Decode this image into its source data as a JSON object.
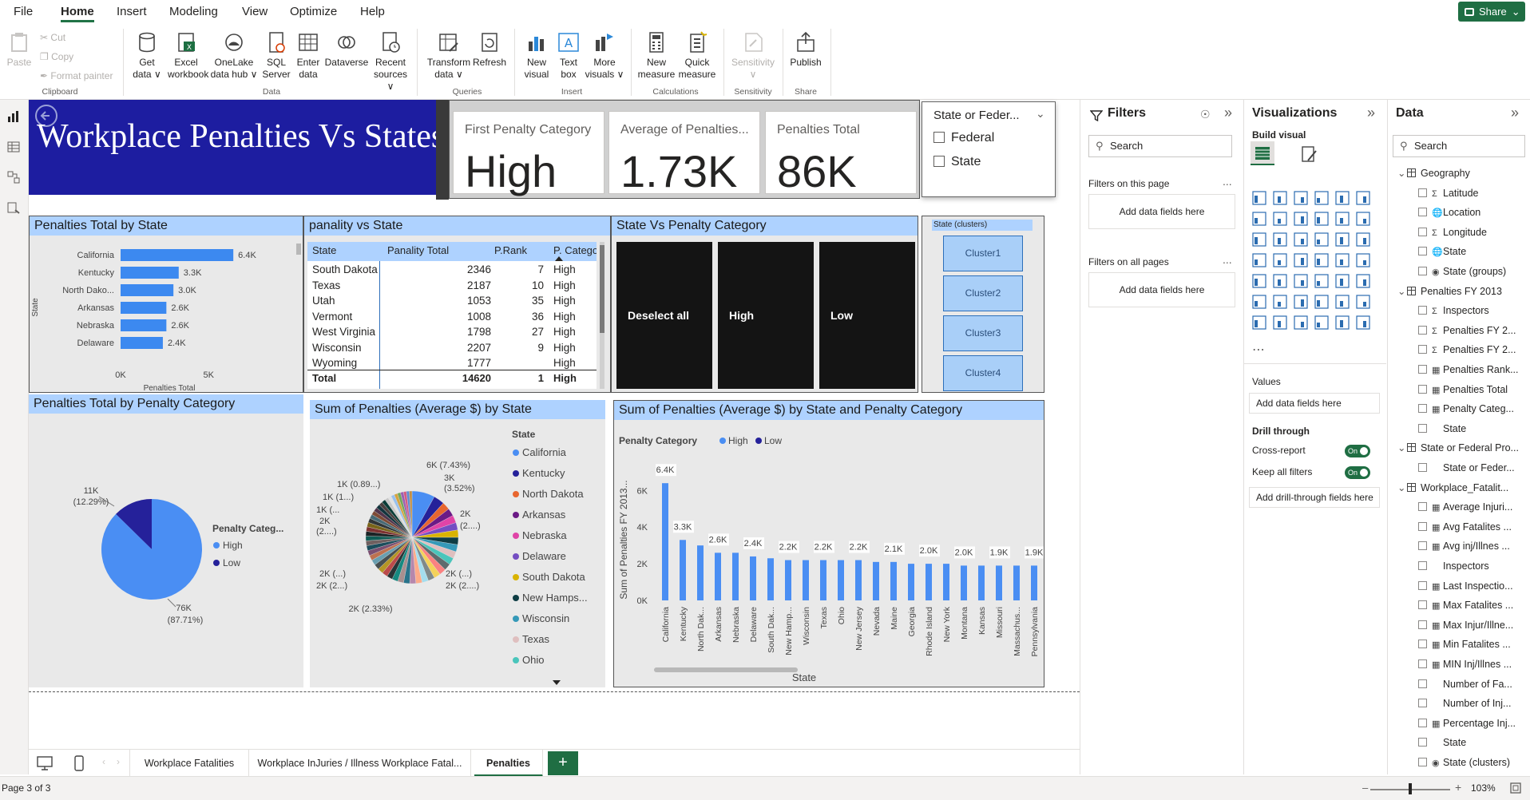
{
  "menu": {
    "items": [
      "File",
      "Home",
      "Insert",
      "Modeling",
      "View",
      "Optimize",
      "Help"
    ],
    "share": "Share"
  },
  "ribbon": {
    "paste": "Paste",
    "cut": "Cut",
    "copy": "Copy",
    "format_painter": "Format painter",
    "get_data": [
      "Get",
      "data ∨"
    ],
    "excel": [
      "Excel",
      "workbook"
    ],
    "onelake": [
      "OneLake",
      "data hub ∨"
    ],
    "sql": [
      "SQL",
      "Server"
    ],
    "enter_data": [
      "Enter",
      "data"
    ],
    "dataverse": "Dataverse",
    "recent": [
      "Recent",
      "sources ∨"
    ],
    "transform": [
      "Transform",
      "data ∨"
    ],
    "refresh": "Refresh",
    "new_visual": [
      "New",
      "visual"
    ],
    "text_box": [
      "Text",
      "box"
    ],
    "more_visuals": [
      "More",
      "visuals ∨"
    ],
    "new_measure": [
      "New",
      "measure"
    ],
    "quick_measure": [
      "Quick",
      "measure"
    ],
    "sensitivity": [
      "Sensitivity",
      "∨"
    ],
    "publish": "Publish",
    "groups": [
      "Clipboard",
      "Data",
      "Queries",
      "Insert",
      "Calculations",
      "Sensitivity",
      "Share"
    ]
  },
  "report": {
    "title": "Workplace Penalties Vs States",
    "cards": [
      {
        "label": "First Penalty Category",
        "value": "High"
      },
      {
        "label": "Average of Penalties...",
        "value": "1.73K"
      },
      {
        "label": "Penalties Total",
        "value": "86K"
      }
    ],
    "slicer": {
      "title": "State or Feder...",
      "options": [
        "Federal",
        "State"
      ]
    },
    "matrix": {
      "title": "panality vs State",
      "headers": [
        "State",
        "Panality Total",
        "P.Rank",
        "P. Categor"
      ],
      "rows": [
        [
          "South Dakota",
          "2346",
          "7",
          "High"
        ],
        [
          "Texas",
          "2187",
          "10",
          "High"
        ],
        [
          "Utah",
          "1053",
          "35",
          "High"
        ],
        [
          "Vermont",
          "1008",
          "36",
          "High"
        ],
        [
          "West Virginia",
          "1798",
          "27",
          "High"
        ],
        [
          "Wisconsin",
          "2207",
          "9",
          "High"
        ],
        [
          "Wyoming",
          "1777",
          "",
          "High"
        ]
      ],
      "total": [
        "Total",
        "14620",
        "1",
        "High"
      ]
    },
    "state_vs_cat": {
      "title": "State Vs Penalty Category",
      "tiles": [
        "Deselect all",
        "High",
        "Low"
      ]
    },
    "clusters": {
      "title": "State (clusters)",
      "items": [
        "Cluster1",
        "Cluster2",
        "Cluster3",
        "Cluster4"
      ]
    }
  },
  "chart_data": [
    {
      "type": "bar",
      "title": "Penalties Total by State",
      "categories": [
        "California",
        "Kentucky",
        "North Dako...",
        "Arkansas",
        "Nebraska",
        "Delaware"
      ],
      "values": [
        6400,
        3300,
        3000,
        2600,
        2600,
        2400
      ],
      "labels": [
        "6.4K",
        "3.3K",
        "3.0K",
        "2.6K",
        "2.6K",
        "2.4K"
      ],
      "xlabel": "Penalties Total",
      "ylabel": "State",
      "xticks": [
        "0K",
        "5K"
      ],
      "xlim": [
        0,
        7000
      ]
    },
    {
      "type": "pie",
      "title": "Penalties Total by Penalty Category",
      "legend_title": "Penalty Categ...",
      "slices": [
        {
          "name": "High",
          "value": 76000,
          "label": "76K",
          "pct": "(87.71%)",
          "color": "#4a8ef3"
        },
        {
          "name": "Low",
          "value": 11000,
          "label": "11K",
          "pct": "(12.29%)",
          "color": "#25219a"
        }
      ]
    },
    {
      "type": "pie",
      "title": "Sum of Penalties (Average $) by State",
      "legend_title": "State",
      "legend": [
        {
          "name": "California",
          "color": "#4a8ef3"
        },
        {
          "name": "Kentucky",
          "color": "#25219a"
        },
        {
          "name": "North Dakota",
          "color": "#e8662f"
        },
        {
          "name": "Arkansas",
          "color": "#6b1a86"
        },
        {
          "name": "Nebraska",
          "color": "#e044a7"
        },
        {
          "name": "Delaware",
          "color": "#744ec2"
        },
        {
          "name": "South Dakota",
          "color": "#d9b300"
        },
        {
          "name": "New Hamps...",
          "color": "#0e3d44"
        },
        {
          "name": "Wisconsin",
          "color": "#3599b8"
        },
        {
          "name": "Texas",
          "color": "#dfbfbf"
        },
        {
          "name": "Ohio",
          "color": "#4ac5bb"
        }
      ],
      "annotations": [
        "6K (7.43%)",
        "3K",
        "(3.52%)",
        "2K",
        "(2....)",
        "2K (...)",
        "2K (2....)",
        "2K (2.33%)",
        "2K (...)",
        "2K (2...)",
        "2K",
        "(2....)",
        "1K (...",
        "1K (1...)",
        "1K (0.89...)"
      ],
      "slice_count": 50
    },
    {
      "type": "bar",
      "title": "Sum of Penalties (Average $) by State and Penalty Category",
      "legend_title": "Penalty Category",
      "series": [
        {
          "name": "High",
          "color": "#4a8ef3"
        },
        {
          "name": "Low",
          "color": "#25219a"
        }
      ],
      "categories": [
        "California",
        "Kentucky",
        "North Dak...",
        "Arkansas",
        "Nebraska",
        "Delaware",
        "South Dak...",
        "New Hamp...",
        "Wisconsin",
        "Texas",
        "Ohio",
        "New Jersey",
        "Nevada",
        "Maine",
        "Georgia",
        "Rhode Island",
        "New York",
        "Montana",
        "Kansas",
        "Missouri",
        "Massachus...",
        "Pennsylvania"
      ],
      "values": [
        6400,
        3300,
        3000,
        2600,
        2600,
        2400,
        2300,
        2200,
        2200,
        2200,
        2200,
        2200,
        2100,
        2100,
        2000,
        2000,
        2000,
        1900,
        1900,
        1900,
        1900,
        1900
      ],
      "labels": [
        "6.4K",
        "3.3K",
        "",
        "2.6K",
        "",
        "2.4K",
        "",
        "2.2K",
        "",
        "2.2K",
        "",
        "2.2K",
        "",
        "2.1K",
        "",
        "2.0K",
        "",
        "2.0K",
        "",
        "1.9K",
        "",
        "1.9K"
      ],
      "xlabel": "State",
      "ylabel": "Sum of Penalties FY 2013...",
      "yticks": [
        "0K",
        "2K",
        "4K",
        "6K"
      ],
      "ylim": [
        0,
        7000
      ]
    }
  ],
  "filters": {
    "title": "Filters",
    "search": "Search",
    "on_page": "Filters on this page",
    "on_all": "Filters on all pages",
    "add": "Add data fields here",
    "more": "..."
  },
  "viz": {
    "title": "Visualizations",
    "build": "Build visual",
    "values": "Values",
    "add_values": "Add data fields here",
    "drill": "Drill through",
    "cross": "Cross-report",
    "keep": "Keep all filters",
    "on": "On",
    "add_drill": "Add drill-through fields here"
  },
  "data": {
    "title": "Data",
    "search": "Search",
    "tree": [
      {
        "t": "Geography",
        "lvl": 0,
        "kind": "table"
      },
      {
        "t": "Latitude",
        "lvl": 1,
        "kind": "sum"
      },
      {
        "t": "Location",
        "lvl": 1,
        "kind": "geo"
      },
      {
        "t": "Longitude",
        "lvl": 1,
        "kind": "sum"
      },
      {
        "t": "State",
        "lvl": 1,
        "kind": "geo"
      },
      {
        "t": "State (groups)",
        "lvl": 1,
        "kind": "grp"
      },
      {
        "t": "Penalties FY 2013",
        "lvl": 0,
        "kind": "table"
      },
      {
        "t": "Inspectors",
        "lvl": 1,
        "kind": "sum"
      },
      {
        "t": "Penalties FY 2...",
        "lvl": 1,
        "kind": "sum"
      },
      {
        "t": "Penalties FY 2...",
        "lvl": 1,
        "kind": "sum"
      },
      {
        "t": "Penalties Rank...",
        "lvl": 1,
        "kind": "calc"
      },
      {
        "t": "Penalties Total",
        "lvl": 1,
        "kind": "calc"
      },
      {
        "t": "Penalty Categ...",
        "lvl": 1,
        "kind": "calc"
      },
      {
        "t": "State",
        "lvl": 1,
        "kind": "none"
      },
      {
        "t": "State or Federal Pro...",
        "lvl": 0,
        "kind": "table"
      },
      {
        "t": "State or Feder...",
        "lvl": 1,
        "kind": "none"
      },
      {
        "t": "Workplace_Fatalit...",
        "lvl": 0,
        "kind": "table"
      },
      {
        "t": "Average Injuri...",
        "lvl": 1,
        "kind": "calc"
      },
      {
        "t": "Avg Fatalites ...",
        "lvl": 1,
        "kind": "calc"
      },
      {
        "t": "Avg inj/Illnes ...",
        "lvl": 1,
        "kind": "calc"
      },
      {
        "t": "Inspectors",
        "lvl": 1,
        "kind": "none"
      },
      {
        "t": "Last Inspectio...",
        "lvl": 1,
        "kind": "calc"
      },
      {
        "t": "Max Fatalites ...",
        "lvl": 1,
        "kind": "calc"
      },
      {
        "t": "Max Injur/Illne...",
        "lvl": 1,
        "kind": "calc"
      },
      {
        "t": "Min Fatalites ...",
        "lvl": 1,
        "kind": "calc"
      },
      {
        "t": "MIN Inj/Illnes ...",
        "lvl": 1,
        "kind": "calc"
      },
      {
        "t": "Number of Fa...",
        "lvl": 1,
        "kind": "none"
      },
      {
        "t": "Number of Inj...",
        "lvl": 1,
        "kind": "none"
      },
      {
        "t": "Percentage Inj...",
        "lvl": 1,
        "kind": "calc"
      },
      {
        "t": "State",
        "lvl": 1,
        "kind": "none"
      },
      {
        "t": "State (clusters)",
        "lvl": 1,
        "kind": "grp"
      },
      {
        "t": "State or Feder...",
        "lvl": 1,
        "kind": "none"
      }
    ]
  },
  "tabs": [
    "Workplace Fatalities",
    "Workplace InJuries / Illness Workplace Fatal...",
    "Penalties"
  ],
  "status": {
    "page": "Page 3 of 3",
    "zoom": "103%"
  }
}
